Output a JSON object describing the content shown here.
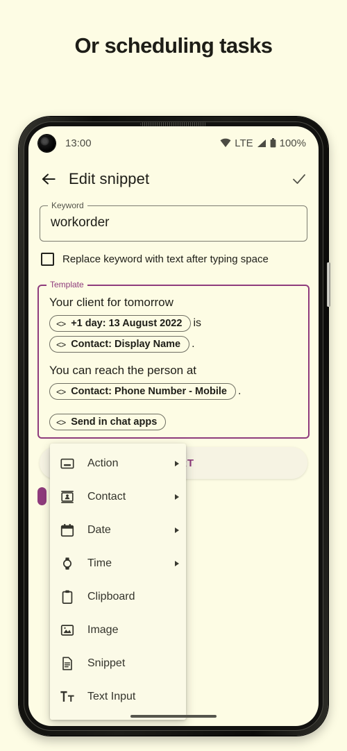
{
  "headline": "Or scheduling tasks",
  "status_bar": {
    "time": "13:00",
    "network": "LTE",
    "battery": "100%",
    "wifi_icon": "wifi-icon",
    "signal_icon": "signal-icon",
    "battery_icon": "battery-icon"
  },
  "app_bar": {
    "back_icon": "back-arrow-icon",
    "title": "Edit snippet",
    "save_icon": "checkmark-icon"
  },
  "keyword_field": {
    "legend": "Keyword",
    "value": "workorder"
  },
  "checkbox": {
    "label": "Replace keyword with text after typing space",
    "checked": false
  },
  "template": {
    "legend": "Template",
    "accent_color": "#8e3b7c",
    "lines": [
      {
        "type": "text",
        "text": "Your client for tomorrow"
      },
      {
        "type": "chip",
        "chip": "+1 day: 13 August 2022",
        "after": "is"
      },
      {
        "type": "chip",
        "chip": "Contact: Display Name",
        "after": "."
      },
      {
        "type": "text",
        "text": "You can reach the person at"
      },
      {
        "type": "chip",
        "chip": "Contact: Phone Number - Mobile",
        "after": "."
      },
      {
        "type": "chip",
        "chip": "Send in chat apps",
        "after": ""
      }
    ],
    "chip_prefix_icon": "code-brackets-icon"
  },
  "insert_button": {
    "label": "INSERT"
  },
  "menu": {
    "items": [
      {
        "label": "Action",
        "icon": "action-button-icon",
        "submenu": true
      },
      {
        "label": "Contact",
        "icon": "contact-card-icon",
        "submenu": true
      },
      {
        "label": "Date",
        "icon": "calendar-icon",
        "submenu": true
      },
      {
        "label": "Time",
        "icon": "watch-icon",
        "submenu": true
      },
      {
        "label": "Clipboard",
        "icon": "clipboard-icon",
        "submenu": false
      },
      {
        "label": "Image",
        "icon": "image-icon",
        "submenu": false
      },
      {
        "label": "Snippet",
        "icon": "document-icon",
        "submenu": false
      },
      {
        "label": "Text Input",
        "icon": "text-input-icon",
        "submenu": false
      }
    ]
  },
  "colors": {
    "background": "#fdfce4",
    "text": "#1d1d17",
    "accent": "#8e3b7c"
  }
}
